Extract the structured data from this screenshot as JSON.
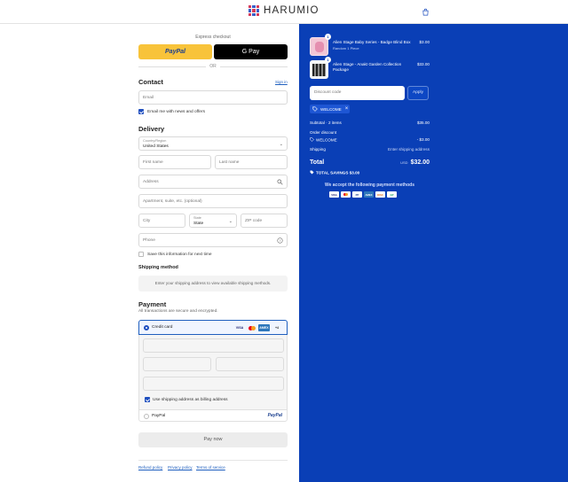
{
  "brand": {
    "name": "HARUMIO"
  },
  "express": {
    "label": "Express checkout",
    "paypal": "PayPal",
    "gpay": "G Pay",
    "or": "OR"
  },
  "contact": {
    "title": "Contact",
    "signin": "Sign in",
    "email_placeholder": "Email",
    "news_label": "Email me with news and offers",
    "news_checked": true
  },
  "delivery": {
    "title": "Delivery",
    "country_label": "Country/Region",
    "country_value": "United States",
    "first_name": "First name",
    "last_name": "Last name",
    "address": "Address",
    "apartment": "Apartment, suite, etc. (optional)",
    "city": "City",
    "state_label": "State",
    "state_value": "State",
    "zip": "ZIP code",
    "phone": "Phone",
    "save_label": "Save this information for next time"
  },
  "shipping_method": {
    "title": "Shipping method",
    "notice": "Enter your shipping address to view available shipping methods."
  },
  "payment": {
    "title": "Payment",
    "subtitle": "All transactions are secure and encrypted.",
    "credit_card": "Credit card",
    "card_brands": [
      "VISA",
      "MC",
      "AMEX",
      "+4"
    ],
    "billing_same": "Use shipping address as billing address",
    "paypal": "PayPal",
    "pay_now": "Pay now"
  },
  "footer_links": [
    "Refund policy",
    "Privacy policy",
    "Terms of service"
  ],
  "order": {
    "items": [
      {
        "name": "Alien Stage Baby Series - Badge Blind Box",
        "variant": "Random 1 Piece",
        "qty": "1",
        "price": "$3.00"
      },
      {
        "name": "Alien Stage - Anakt Garden Collection Package",
        "variant": "",
        "qty": "1",
        "price": "$33.00"
      }
    ],
    "discount_placeholder": "Discount code",
    "apply": "Apply",
    "applied_code": "WELCOME",
    "subtotal_label": "Subtotal · 2 items",
    "subtotal_value": "$35.00",
    "order_discount_label": "Order discount",
    "discount_code_label": "WELCOME",
    "discount_value": "- $3.00",
    "shipping_label": "Shipping",
    "shipping_value": "Enter shipping address",
    "total_label": "Total",
    "currency": "USD",
    "total_value": "$32.00",
    "savings_label": "TOTAL SAVINGS",
    "savings_value": "$3.00",
    "accept_text": "We accept the following payment methods",
    "payment_methods": [
      "VISA",
      "MC",
      "PP",
      "AMEX",
      "DISC",
      "GP"
    ]
  },
  "colors": {
    "panel": "#0a3fb6",
    "accent": "#1f4fbf",
    "paypal_yellow": "#f8c33a"
  }
}
